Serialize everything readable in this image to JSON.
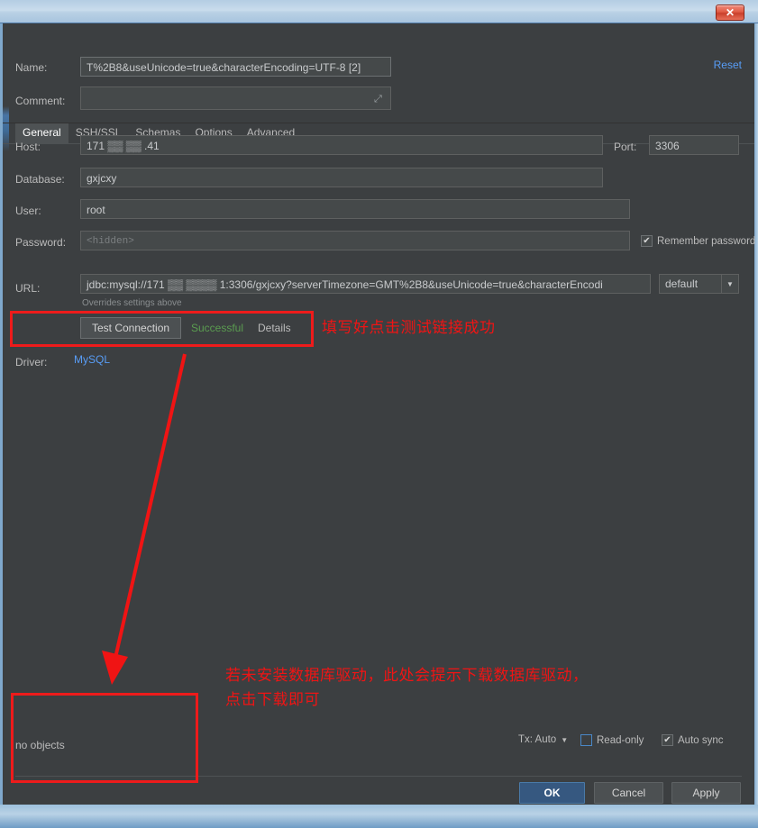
{
  "window": {
    "close_icon": "close-icon",
    "close_glyph": "✕"
  },
  "header": {
    "name_label": "Name:",
    "name_value": "T%2B8&useUnicode=true&characterEncoding=UTF-8 [2]",
    "comment_label": "Comment:",
    "comment_value": "",
    "comment_expand_icon": "expand-icon",
    "reset_label": "Reset"
  },
  "tabs": [
    {
      "label": "General",
      "active": true
    },
    {
      "label": "SSH/SSL",
      "active": false
    },
    {
      "label": "Schemas",
      "active": false
    },
    {
      "label": "Options",
      "active": false
    },
    {
      "label": "Advanced",
      "active": false
    }
  ],
  "general": {
    "host_label": "Host:",
    "host_value": "171 ▒▒   ▒▒ .41",
    "port_label": "Port:",
    "port_value": "3306",
    "database_label": "Database:",
    "database_value": "gxjcxy",
    "user_label": "User:",
    "user_value": "root",
    "password_label": "Password:",
    "password_placeholder": "<hidden>",
    "remember_password_label": "Remember password",
    "remember_password_checked": true,
    "url_label": "URL:",
    "url_value": "jdbc:mysql://171 ▒▒  ▒▒▒▒ 1:3306/gxjcxy?serverTimezone=GMT%2B8&useUnicode=true&characterEncodi",
    "url_mode": "default",
    "overrides_note": "Overrides settings above",
    "test_connection_label": "Test Connection",
    "test_status": "Successful",
    "details_label": "Details",
    "driver_label": "Driver:",
    "driver_value": "MySQL"
  },
  "bottom": {
    "no_objects": "no objects",
    "tx_label": "Tx: Auto",
    "read_only_label": "Read-only",
    "read_only_checked": false,
    "auto_sync_label": "Auto sync",
    "auto_sync_checked": true,
    "ok_label": "OK",
    "cancel_label": "Cancel",
    "apply_label": "Apply"
  },
  "annotations": {
    "note_test": "填写好点击测试链接成功",
    "note_driver_line1": "若未安装数据库驱动，此处会提示下载数据库驱动，",
    "note_driver_line2": "点击下载即可"
  },
  "colors": {
    "annotation_red": "#f01414",
    "link_blue": "#589df6",
    "success_green": "#5a9c50",
    "primary_button": "#365880"
  }
}
